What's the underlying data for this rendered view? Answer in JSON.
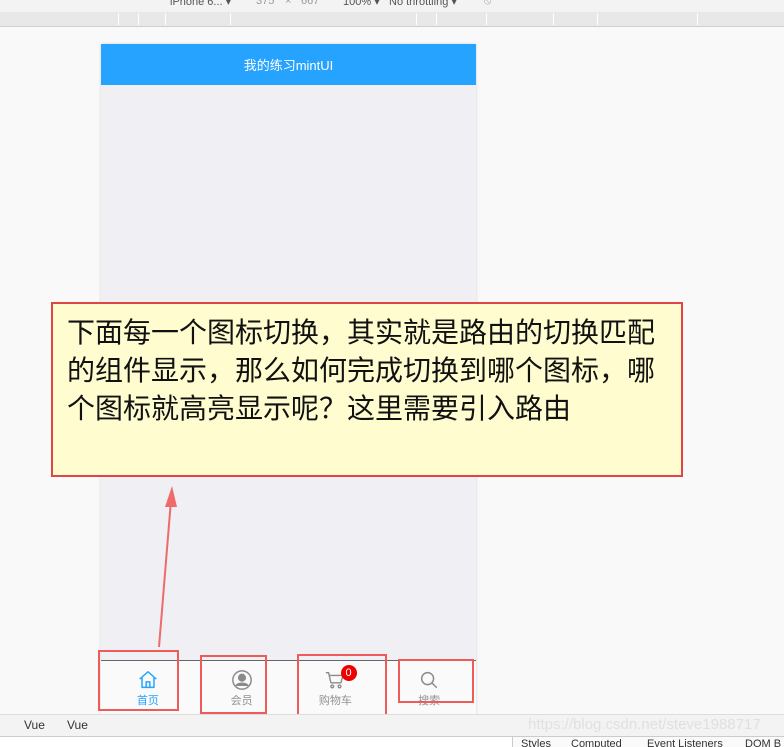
{
  "devtools": {
    "device": "iPhone 6...",
    "width": "375",
    "times": "×",
    "height": "667",
    "zoom": "100%",
    "throttling": "No throttling",
    "bottom_tabs": [
      "Vue",
      "Vue"
    ],
    "side_tabs": [
      "Styles",
      "Computed",
      "Event Listeners",
      "DOM B"
    ]
  },
  "app": {
    "title": "我的练习mintUI",
    "tabs": [
      {
        "label": "首页",
        "icon": "home-icon",
        "active": true
      },
      {
        "label": "会员",
        "icon": "member-icon",
        "active": false
      },
      {
        "label": "购物车",
        "icon": "cart-icon",
        "active": false,
        "badge": "0"
      },
      {
        "label": "搜索",
        "icon": "search-icon",
        "active": false
      }
    ]
  },
  "annotation": {
    "text": "下面每一个图标切换，其实就是路由的切换匹配的组件显示，那么如何完成切换到哪个图标，哪个图标就高亮显示呢？这里需要引入路由"
  },
  "watermark": "https://blog.csdn.net/steve1988717",
  "colors": {
    "header": "#26a2ff",
    "active_tab": "#26a2ff",
    "badge": "#ef0000",
    "annotation_border": "#e04545",
    "annotation_bg": "#fffdd0"
  }
}
